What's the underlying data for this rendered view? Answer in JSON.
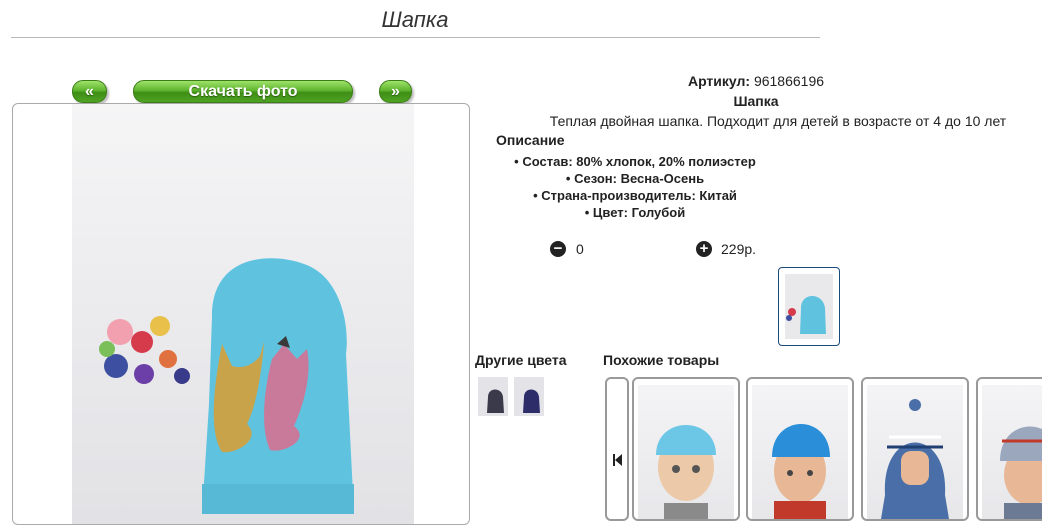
{
  "page": {
    "title": "Шапка"
  },
  "gallery": {
    "prev_label": "«",
    "download_label": "Скачать фото",
    "next_label": "»"
  },
  "product": {
    "article_label": "Артикул:",
    "article_value": "961866196",
    "name": "Шапка",
    "description": "Теплая двойная шапка. Подходит для детей в возрасте от 4 до 10 лет",
    "description_title": "Описание",
    "properties": [
      "Состав: 80% хлопок, 20% полиэстер",
      "Сезон: Весна-Осень",
      "Страна-производитель: Китай",
      "Цвет: Голубой"
    ]
  },
  "cart": {
    "minus_icon": "minus-circle-icon",
    "quantity": "0",
    "plus_icon": "plus-circle-icon",
    "price": "229р."
  },
  "sections": {
    "other_colors": "Другие цвета",
    "similar_products": "Похожие товары"
  },
  "colors": {
    "hat_blue": "#5fc3df",
    "sequin_gold": "#c9a34a",
    "sequin_pink": "#c97a9a",
    "accent_green": "#5fb52e"
  }
}
